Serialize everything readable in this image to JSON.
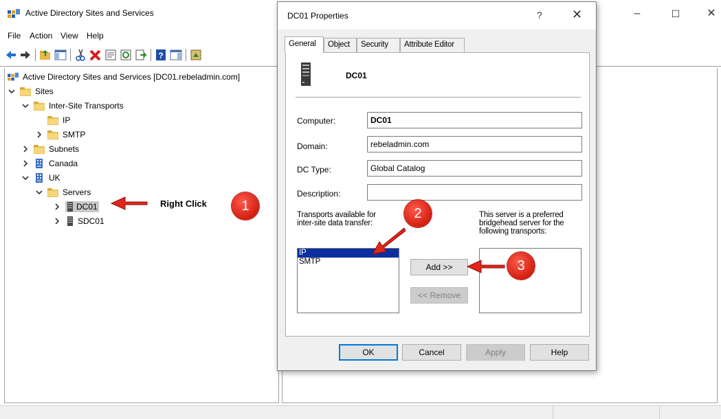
{
  "window": {
    "title": "Active Directory Sites and Services",
    "controls": {
      "minimize": "–",
      "maximize": "☐",
      "close": "✕"
    }
  },
  "menu": [
    "File",
    "Action",
    "View",
    "Help"
  ],
  "toolbar": {
    "buttons": [
      "back-icon",
      "forward-icon",
      "up-folder-icon",
      "show-hide-tree-icon",
      "cut-icon",
      "delete-icon",
      "properties-icon",
      "refresh-icon",
      "export-icon",
      "help-icon",
      "action-pane-icon",
      "ntds-icon"
    ]
  },
  "tree": {
    "root": "Active Directory Sites and Services [DC01.rebeladmin.com]",
    "sites": "Sites",
    "inter_site_transports": "Inter-Site Transports",
    "ip": "IP",
    "smtp": "SMTP",
    "subnets": "Subnets",
    "canada": "Canada",
    "uk": "UK",
    "servers": "Servers",
    "dc01": "DC01",
    "sdc01": "SDC01"
  },
  "annotations": {
    "right_click": "Right Click",
    "step1": "1",
    "step2": "2",
    "step3": "3",
    "color": "#e0261b"
  },
  "dialog": {
    "title": "DC01 Properties",
    "help": "?",
    "close": "✕",
    "tabs": [
      "General",
      "Object",
      "Security",
      "Attribute Editor"
    ],
    "active_tab": "General",
    "server_name": "DC01",
    "fields": {
      "computer_label": "Computer:",
      "computer_value": "DC01",
      "domain_label": "Domain:",
      "domain_value": "rebeladmin.com",
      "dc_type_label": "DC Type:",
      "dc_type_value": "Global Catalog",
      "description_label": "Description:",
      "description_value": ""
    },
    "transports_available_label": [
      "Transports available for",
      "inter-site data transfer:"
    ],
    "transports_available": [
      {
        "label": "IP",
        "selected": true
      },
      {
        "label": "SMTP",
        "selected": false
      }
    ],
    "preferred_label": [
      "This server is a preferred",
      "bridgehead server for the",
      "following transports:"
    ],
    "preferred_transports": [],
    "add_button": "Add >>",
    "remove_button": "<< Remove",
    "remove_enabled": false,
    "footer": {
      "ok": "OK",
      "cancel": "Cancel",
      "apply": "Apply",
      "help": "Help",
      "apply_enabled": false
    }
  }
}
